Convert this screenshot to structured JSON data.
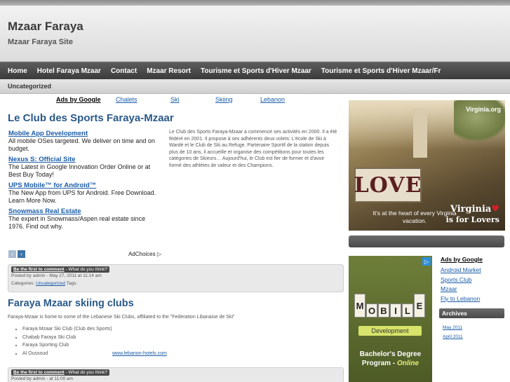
{
  "site": {
    "title": "Mzaar Faraya",
    "description": "Mzaar Faraya Site"
  },
  "nav": {
    "items": [
      "Home",
      "Hotel Faraya Mzaar",
      "Contact",
      "Mzaar Resort",
      "Tourisme et Sports d'Hiver Mzaar",
      "Tourisme et Sports d'Hiver Mzaar/Fr"
    ],
    "sub_item": "Uncategorized"
  },
  "ad_links": {
    "label": "Ads by Google",
    "items": [
      "Chalets",
      "Ski",
      "Skiing",
      "Lebanon"
    ]
  },
  "post1": {
    "title": "Le Club des Sports Faraya-Mzaar",
    "body": "Le Club des Sports Faraya-Mzaar a commencé ses activités en 2000. Il a été fédéré en 2001. Il propose à ses adhérents deux volets: L'école de Ski à Wardé et le Club de Ski au Refuge. Partenaire Sportif de la station depuis plus de 10 ans, il accueille et organise des compétitions pour toutes les catégories de Skieurs… Aujourd'hui, le Club est fier de former et d'avoir formé des athlètes de valeur et des Champions.",
    "comment_link": "Be the first to comment",
    "comment_tail": " - What do you think?",
    "posted": "Posted by admin - May 27, 2011 at 11:14 am",
    "categories_label": "Categories:",
    "category": "Uncategorized",
    "tags_label": "Tags:"
  },
  "text_ads": [
    {
      "title": "Mobile App Development",
      "desc": "All mobile OSes targeted. We deliver on time and on budget."
    },
    {
      "title": "Nexus S: Official Site",
      "desc": "The Latest in Google Innovation Order Online or at Best Buy Today!"
    },
    {
      "title": "UPS Mobile™ for Android™",
      "desc": "The New App from UPS for Android. Free Download. Learn More Now."
    },
    {
      "title": "Snowmass Real Estate",
      "desc": "The expert in Snowmass/Aspen real estate since 1976. Find out why."
    }
  ],
  "ad_nav": {
    "prev": "‹",
    "next": "›",
    "adchoices": "AdChoices ▷"
  },
  "post2": {
    "title": "Faraya Mzaar skiing clubs",
    "intro": "Faraya-Mzaar is home to some of the Lebanese Ski Clubs, affiliated to the \"Federation Libanaise de Ski\"",
    "clubs": [
      "Faraya Mzaar Ski Club (Club des Sports)",
      "Chabab Faraya Ski Club",
      "Faraya Sporting Club",
      "Al Oussoud"
    ],
    "link": "www.lebanon-hotels.com",
    "comment_link": "Be the first to comment",
    "comment_tail": " - What do you think?",
    "posted": "Posted by admin - at 11:00 am"
  },
  "banner_ad": {
    "site": "Virginia.org",
    "love": "LOVE",
    "caption": "It's at the heart of every Virginia vacation.",
    "brand_line1": "Virginia",
    "brand_heart": "♥",
    "brand_line2": "is for Lovers"
  },
  "mobile_ad": {
    "tiles": [
      "M",
      "O",
      "B",
      "I",
      "L",
      "E"
    ],
    "subtitle": "Development",
    "line1": "Bachelor's Degree",
    "line2_prefix": "Program - ",
    "line2_em": "Online",
    "badge": "▷"
  },
  "side_links": {
    "label": "Ads by Google",
    "items": [
      "Android Market",
      "Sports Club",
      "Mzaar",
      "Fly to Lebanon"
    ]
  },
  "archives": {
    "title": "Archives",
    "items": [
      "May 2011",
      "April 2011"
    ]
  }
}
